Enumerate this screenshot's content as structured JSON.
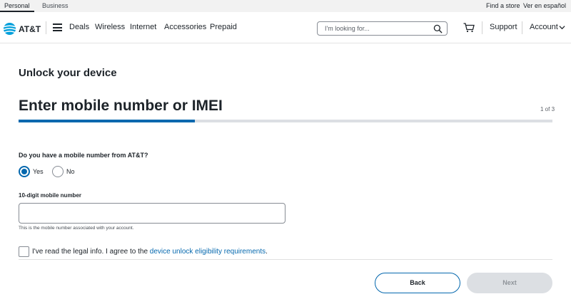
{
  "utility": {
    "personal": "Personal",
    "business": "Business",
    "find_store": "Find a store",
    "spanish": "Ver en español"
  },
  "nav": {
    "logo_text": "AT&T",
    "links": [
      "Deals",
      "Wireless",
      "Internet",
      "Accessories",
      "Prepaid"
    ],
    "search_placeholder": "I'm looking for...",
    "support": "Support",
    "account": "Account"
  },
  "page": {
    "subtitle": "Unlock your device",
    "step_title": "Enter mobile number or IMEI",
    "step_count": "1 of 3",
    "progress": 0.33
  },
  "form": {
    "question": "Do you have a mobile number from AT&T?",
    "options": [
      {
        "label": "Yes",
        "selected": true
      },
      {
        "label": "No",
        "selected": false
      }
    ],
    "number_label": "10-digit mobile number",
    "number_value": "",
    "number_helper": "This is the mobile number associated with your account.",
    "agree_text": "I've read the legal info. I agree to the ",
    "agree_link": "device unlock eligibility requirements",
    "agree_end": ".",
    "agree_checked": false
  },
  "buttons": {
    "back": "Back",
    "next": "Next"
  },
  "colors": {
    "accent": "#0568ae",
    "text": "#1d2329",
    "disabled_bg": "#dcdfe3",
    "disabled_text": "#8f949a"
  },
  "icons": [
    "att-globe-icon",
    "menu-icon",
    "search-icon",
    "cart-icon",
    "chevron-down-icon"
  ]
}
